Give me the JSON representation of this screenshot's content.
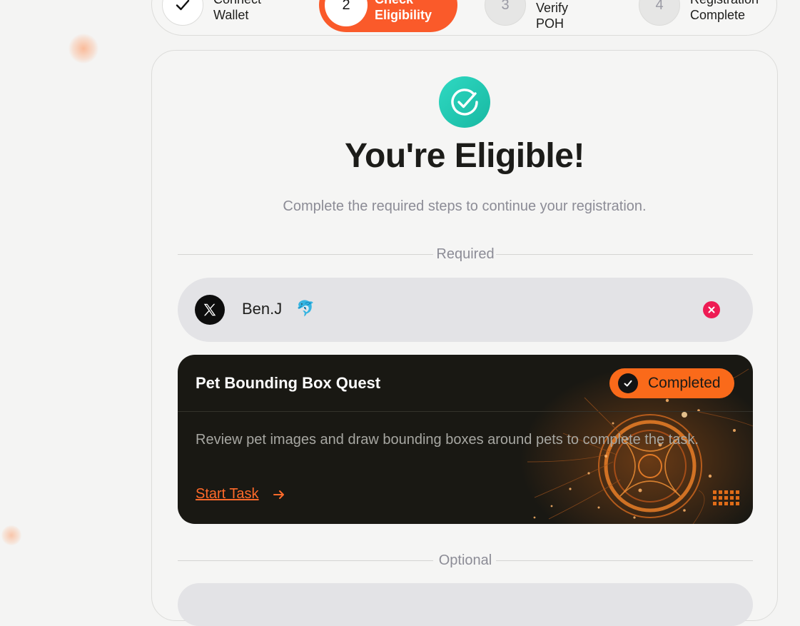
{
  "stepper": {
    "steps": [
      {
        "number": "",
        "label": "Connect\nWallet",
        "state": "done",
        "icon": "check-icon"
      },
      {
        "number": "2",
        "label": "Check\nEligibility",
        "state": "active"
      },
      {
        "number": "3",
        "label": "Verify POH",
        "state": "pending"
      },
      {
        "number": "4",
        "label": "Registration\nComplete",
        "state": "pending"
      }
    ]
  },
  "main": {
    "icon": "check-circle-icon",
    "title": "You're Eligible!",
    "subtitle": "Complete the required steps to continue your registration.",
    "required_label": "Required",
    "optional_label": "Optional"
  },
  "account": {
    "platform_icon": "x-logo-icon",
    "name": "Ben.J",
    "emoji": "🐬",
    "remove_icon": "close-icon"
  },
  "quest": {
    "title": "Pet Bounding Box Quest",
    "status": "Completed",
    "description": "Review pet images and draw bounding boxes around pets to complete the task.",
    "cta": "Start Task",
    "cta_icon": "arrow-right-icon"
  },
  "colors": {
    "accent": "#fa5a2a",
    "badge": "#fa6a1a",
    "teal": "#1fc9b2",
    "danger": "#ee1c54",
    "quest_bg": "#191813"
  }
}
